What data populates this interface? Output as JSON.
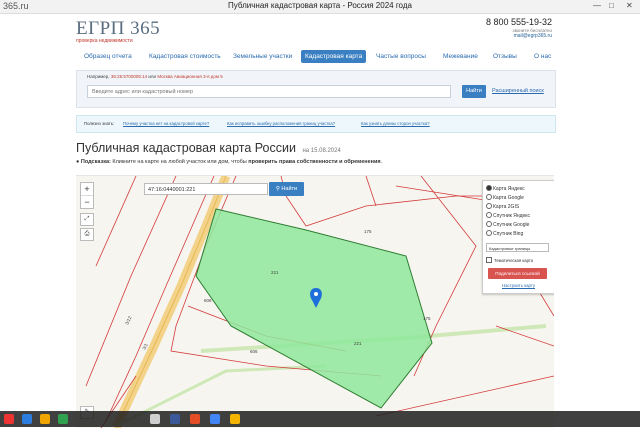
{
  "browser": {
    "url_fragment": "365.ru",
    "window_title": "Публичная кадастровая карта - Россия 2024 года",
    "controls": [
      "—",
      "□",
      "✕"
    ]
  },
  "header": {
    "logo": "ЕГРП 365",
    "logo_sub": "проверка недвижимости",
    "phone": "8 800 555-19-32",
    "phone_note": "звоните бесплатно",
    "email": "mail@egrp365.ru"
  },
  "nav": {
    "items": [
      "Образец отчета",
      "Кадастровая стоимость",
      "Земельные участки",
      "Кадастровая карта",
      "Частые вопросы",
      "Межевание",
      "Отзывы",
      "О нас"
    ],
    "active": "Кадастровая карта"
  },
  "search": {
    "example_label": "Например,",
    "example_number": "36:25:5700005:14",
    "example_or": "или",
    "example_address": "Москва Авиационная 3-я дом 5",
    "placeholder": "Введите адрес или кадастровый номер",
    "button": "Найти",
    "advanced": "Расширенный поиск"
  },
  "useful": {
    "label": "Полезно знать:",
    "links": [
      "Почему участка нет на кадастровой карте?",
      "Как исправить ошибку расположения границ участка?",
      "Как узнать длины сторон участка?"
    ]
  },
  "page": {
    "title": "Публичная кадастровая карта России",
    "date": "на 15.08.2024",
    "hint_label": "Подсказка:",
    "hint_text": "Кликните на карте на любой участок или дом, чтобы",
    "hint_bold": "проверить права собственности и обременения",
    "hint_end": "."
  },
  "map": {
    "zoom_in": "+",
    "zoom_out": "−",
    "search_value": "47:16:0440001:221",
    "search_button": "Найти",
    "layers": [
      "Карта Яндекс",
      "Карта Google",
      "Карта 2GIS",
      "Спутник Яндекс",
      "Спутник Google",
      "Спутник Bing"
    ],
    "selected_layer": "Карта Яндекс",
    "boundaries_select": "Кадастровые границы",
    "thematic_checkbox": "Тематическая карта",
    "share_button": "Поделиться ссылкой",
    "configure_link": "Настроить карту",
    "parcel_labels": [
      "221",
      "175",
      "175",
      "606",
      "606",
      "221",
      "3/12",
      "3/1"
    ]
  },
  "colors": {
    "accent": "#3a7fc1",
    "parcel_fill": "#8fe89b",
    "parcel_stroke": "#2e7d32",
    "boundary": "#d33a3a",
    "share": "#d9534f"
  }
}
